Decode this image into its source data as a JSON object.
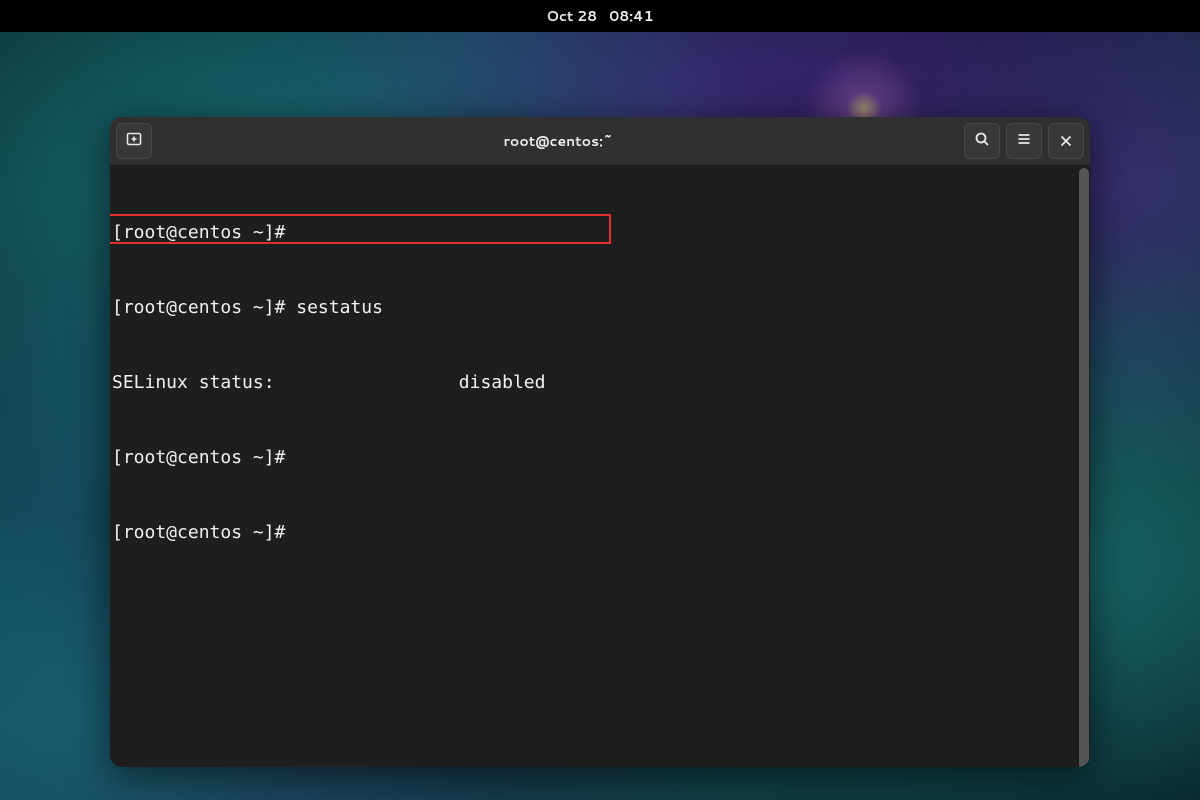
{
  "topbar": {
    "date": "Oct 28",
    "time": "08:41"
  },
  "window": {
    "title": "root@centos:~"
  },
  "terminal": {
    "lines": [
      "[root@centos ~]# ",
      "[root@centos ~]# sestatus",
      "SELinux status:                 disabled",
      "[root@centos ~]# ",
      "[root@centos ~]# "
    ]
  },
  "icons": {
    "newtab": "new-tab-icon",
    "search": "search-icon",
    "menu": "hamburger-icon",
    "close": "close-icon"
  },
  "annotation": {
    "highlight_line_index": 2
  }
}
